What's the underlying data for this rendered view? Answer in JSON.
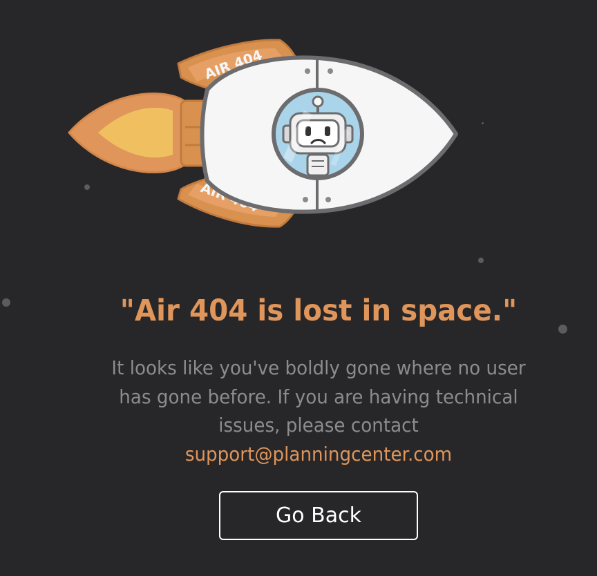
{
  "illustration": {
    "fin_top_text": "AIR 404",
    "fin_bottom_text": "AIR 404",
    "colors": {
      "background": "#272729",
      "orange": "#e0955a",
      "fin_orange": "#d9914f",
      "flame_inner": "#f0c060",
      "hull": "#f6f6f6",
      "outline": "#6c6c6e",
      "porthole_glass": "#a9d4ea"
    },
    "icons": [
      "rocket-icon",
      "robot-astronaut-icon",
      "flame-icon",
      "star-icon"
    ]
  },
  "error": {
    "headline": "\"Air 404 is lost in space.\"",
    "message": "It looks like you've boldly gone where no user has gone before. If you are having technical issues, please contact",
    "support_email": "support@planningcenter.com"
  },
  "actions": {
    "go_back_label": "Go Back"
  },
  "colors": {
    "accent": "#e0955a",
    "text_muted": "#8c8c90",
    "button_border": "#ffffff"
  }
}
